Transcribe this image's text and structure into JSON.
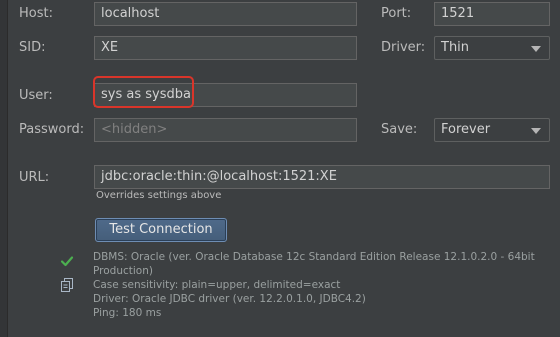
{
  "form": {
    "host_label": "Host:",
    "host_value": "localhost",
    "port_label": "Port:",
    "port_value": "1521",
    "sid_label": "SID:",
    "sid_value": "XE",
    "driver_label": "Driver:",
    "driver_value": "Thin",
    "user_label": "User:",
    "user_value": "sys as sysdba",
    "password_label": "Password:",
    "password_placeholder": "<hidden>",
    "save_label": "Save:",
    "save_value": "Forever",
    "url_label": "URL:",
    "url_value": "jdbc:oracle:thin:@localhost:1521:XE",
    "url_hint": "Overrides settings above",
    "test_button": "Test Connection"
  },
  "status": {
    "lines": [
      "DBMS: Oracle (ver. Oracle Database 12c Standard Edition Release 12.1.0.2.0 - 64bit",
      "Production)",
      "Case sensitivity: plain=upper, delimited=exact",
      "Driver: Oracle JDBC driver (ver. 12.2.0.1.0, JDBC4.2)",
      "Ping: 180 ms"
    ]
  },
  "icons": {
    "success": "check-icon",
    "copy": "copy-icon"
  },
  "colors": {
    "background": "#3c3f41",
    "highlight": "#d9352a",
    "success": "#4caf50"
  }
}
